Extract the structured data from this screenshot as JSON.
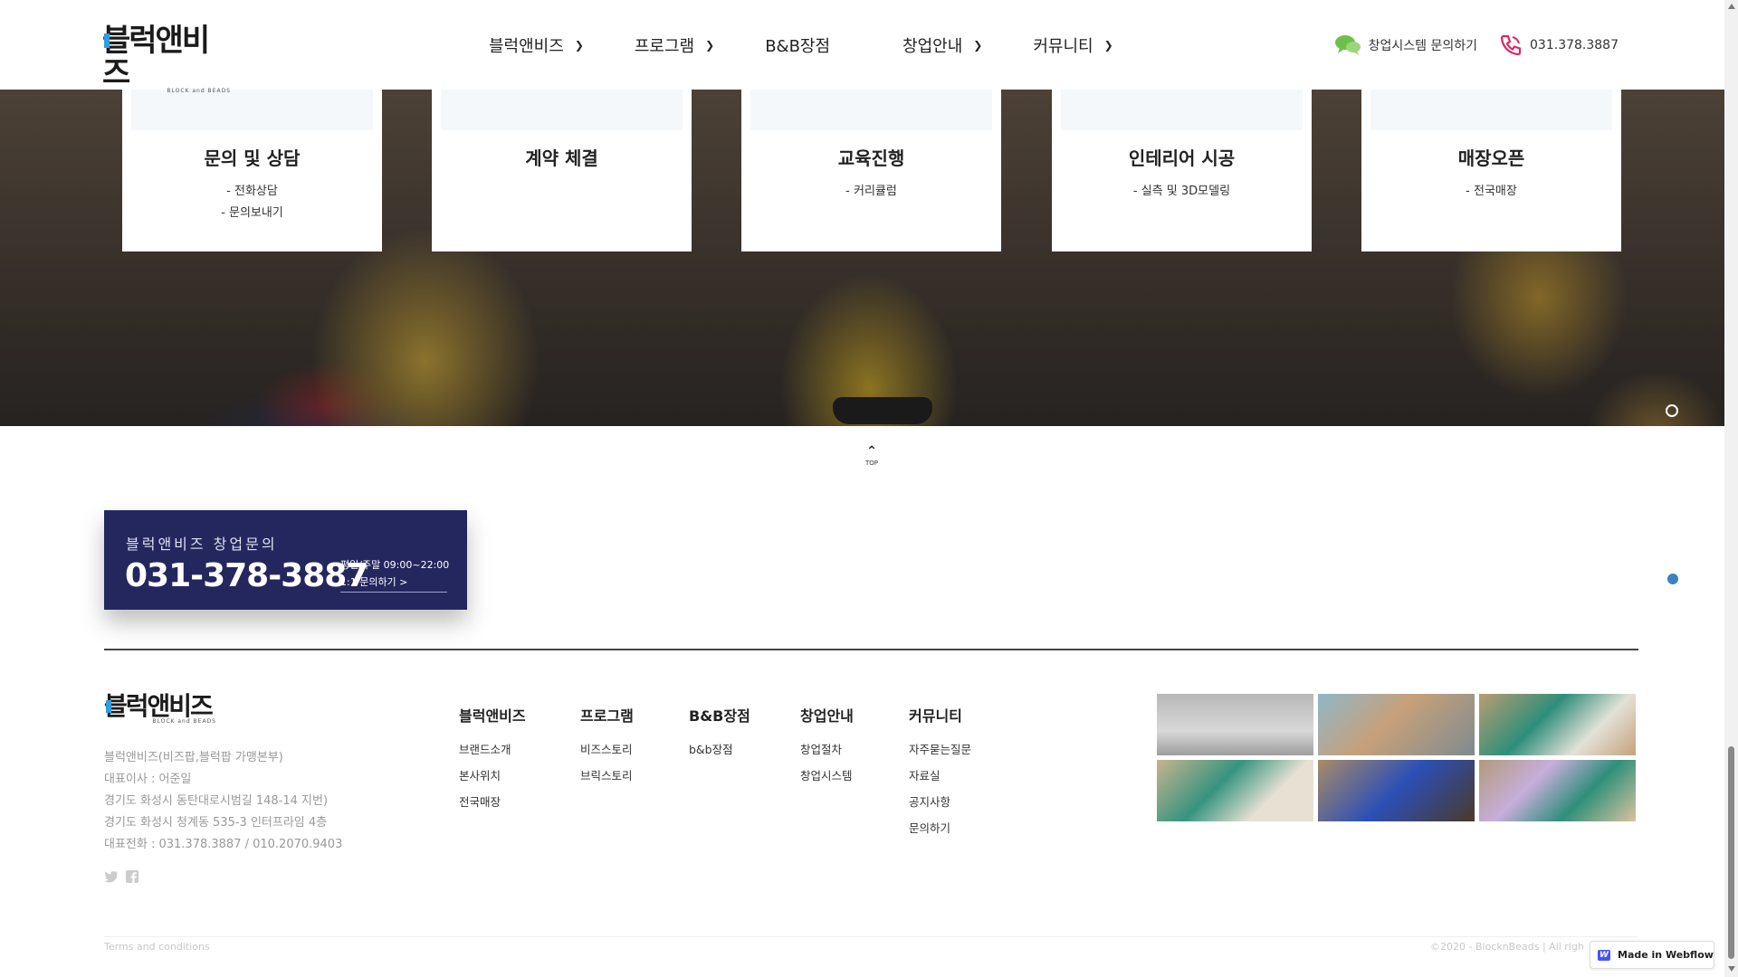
{
  "header": {
    "logo_text": "블럭앤비즈",
    "logo_sub": "BLOCK and BEADS",
    "nav": [
      {
        "label": "블럭앤비즈",
        "has_dropdown": true
      },
      {
        "label": "프로그램",
        "has_dropdown": true
      },
      {
        "label": "B&B장점",
        "has_dropdown": false
      },
      {
        "label": "창업안내",
        "has_dropdown": true
      },
      {
        "label": "커뮤니티",
        "has_dropdown": true
      }
    ],
    "inquiry_label": "창업시스템 문의하기",
    "phone": "031.378.3887"
  },
  "steps": [
    {
      "title": "문의 및 상담",
      "subs": [
        "- 전화상담",
        "- 문의보내기"
      ]
    },
    {
      "title": "계약 체결",
      "subs": []
    },
    {
      "title": "교육진행",
      "subs": [
        "- 커리큘럼"
      ]
    },
    {
      "title": "인테리어 시공",
      "subs": [
        "- 실측 및 3D모델링"
      ]
    },
    {
      "title": "매장오픈",
      "subs": [
        "- 전국매장"
      ]
    }
  ],
  "top_button": {
    "label": "TOP"
  },
  "contact": {
    "title": "블럭앤비즈 창업문의",
    "phone": "031-378-3887",
    "hours": "평일/주말 09:00~22:00",
    "link": "1:1 문의하기 >"
  },
  "footer": {
    "logo_text": "블럭앤비즈",
    "logo_sub": "BLOCK and BEADS",
    "info": [
      "블럭앤비즈(비즈팝,블럭팝 가맹본부)",
      "대표이사 : 어준일",
      "경기도 화성시 동탄대로시범길 148-14 지번)",
      "경기도 화성시 청계동 535-3 인터프라임 4층",
      "대표전화 : 031.378.3887 / 010.2070.9403"
    ],
    "columns": [
      {
        "title": "블럭앤비즈",
        "items": [
          "브랜드소개",
          "본사위치",
          "전국매장"
        ]
      },
      {
        "title": "프로그램",
        "items": [
          "비즈스토리",
          "브릭스토리"
        ]
      },
      {
        "title": "B&B장점",
        "items": [
          "b&b장점"
        ]
      },
      {
        "title": "창업안내",
        "items": [
          "창업절차",
          "창업시스템"
        ]
      },
      {
        "title": "커뮤니티",
        "items": [
          "자주묻는질문",
          "자료실",
          "공지사항",
          "문의하기"
        ]
      }
    ],
    "terms": "Terms and conditions",
    "copyright": "©2020 - BlocknBeads |   All righ",
    "webflow_badge": "Made in Webflow"
  },
  "colors": {
    "contact_bg": "#24275e",
    "accent_blue": "#3b82c4",
    "phone_icon": "#e0245e",
    "chat_icon": "#6cc04a"
  }
}
